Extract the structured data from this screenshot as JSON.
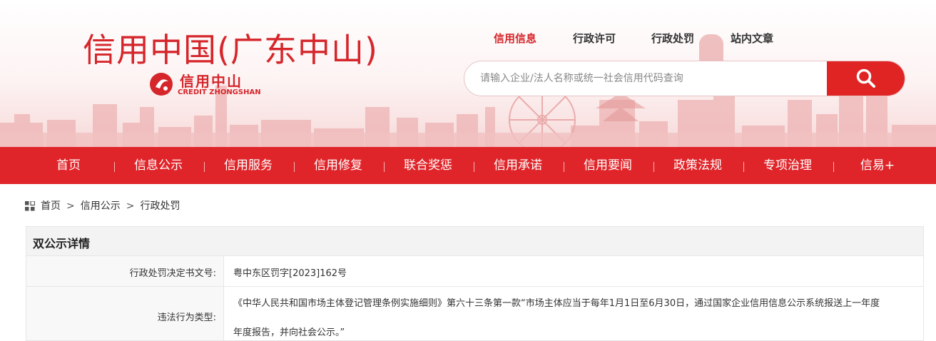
{
  "header": {
    "site_title": "信用中国(广东中山)",
    "logo_cn": "信用中山",
    "logo_en": "CREDIT ZHONGSHAN",
    "top_links": [
      "信用信息",
      "行政许可",
      "行政处罚",
      "站内文章"
    ],
    "active_top_link": "信用信息",
    "search_placeholder": "请输入企业/法人名称或统一社会信用代码查询",
    "search_icon": "search-icon"
  },
  "nav": {
    "items": [
      "首页",
      "信息公示",
      "信用服务",
      "信用修复",
      "联合奖惩",
      "信用承诺",
      "信用要闻",
      "政策法规",
      "专项治理",
      "信易+"
    ]
  },
  "breadcrumb": {
    "icon": "grid-icon",
    "items": [
      "首页",
      "信用公示",
      "行政处罚"
    ],
    "separator": ">"
  },
  "detail": {
    "title": "双公示详情",
    "rows": [
      {
        "label": "行政处罚决定书文号:",
        "value": "粤中东区罚字[2023]162号"
      },
      {
        "label": "违法行为类型:",
        "value_line1": "《中华人民共和国市场主体登记管理条例实施细则》第六十三条第一款“市场主体应当于每年1月1日至6月30日，通过国家企业信用信息公示系统报送上一年度",
        "value_line2": "年度报告，并向社会公示。”"
      }
    ]
  },
  "colors": {
    "brand_red": "#e0252a",
    "title_red": "#d5262b"
  }
}
